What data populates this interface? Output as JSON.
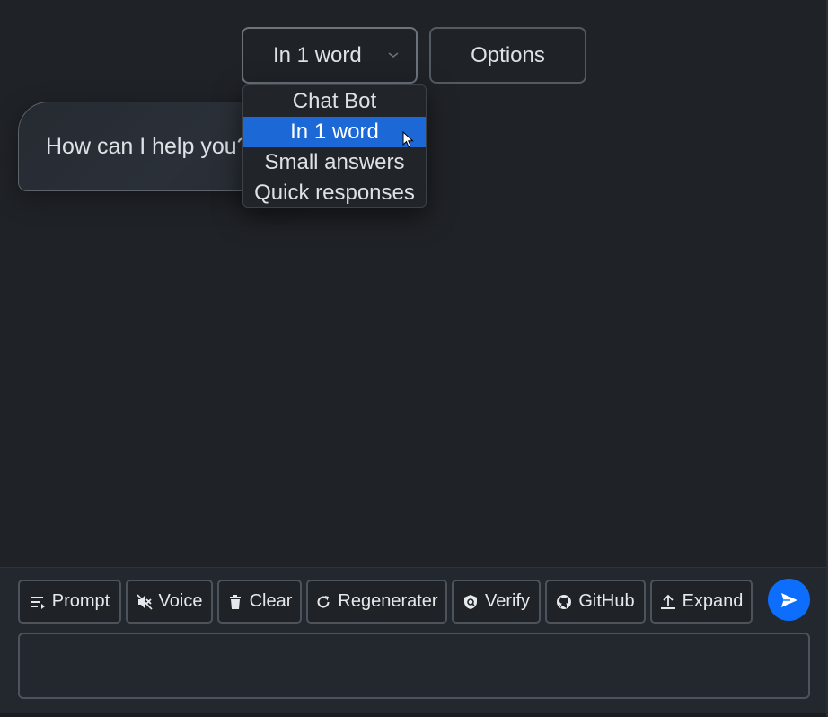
{
  "header": {
    "mode_selected": "In 1 word",
    "options_label": "Options"
  },
  "chat": {
    "assistant_greeting": "How can I help you?"
  },
  "mode_dropdown": {
    "options": [
      "Chat Bot",
      "In 1 word",
      "Small answers",
      "Quick responses"
    ],
    "highlighted": "In 1 word"
  },
  "toolbar": {
    "prompt": "Prompt",
    "voice": "Voice",
    "clear": "Clear",
    "regenerate": "Regenerater",
    "verify": "Verify",
    "github": "GitHub",
    "expand": "Expand"
  },
  "composer": {
    "value": "",
    "placeholder": ""
  },
  "colors": {
    "background": "#1f2227",
    "accent": "#0d6efd",
    "selected_option": "#1c68d6"
  },
  "icons": {
    "mode_select": "chevron-down-icon",
    "prompt": "list-icon",
    "voice": "speaker-muted-icon",
    "clear": "trash-icon",
    "regenerate": "refresh-icon",
    "verify": "shield-check-icon",
    "github": "github-icon",
    "expand": "upload-arrow-icon",
    "send": "paper-plane-icon"
  }
}
